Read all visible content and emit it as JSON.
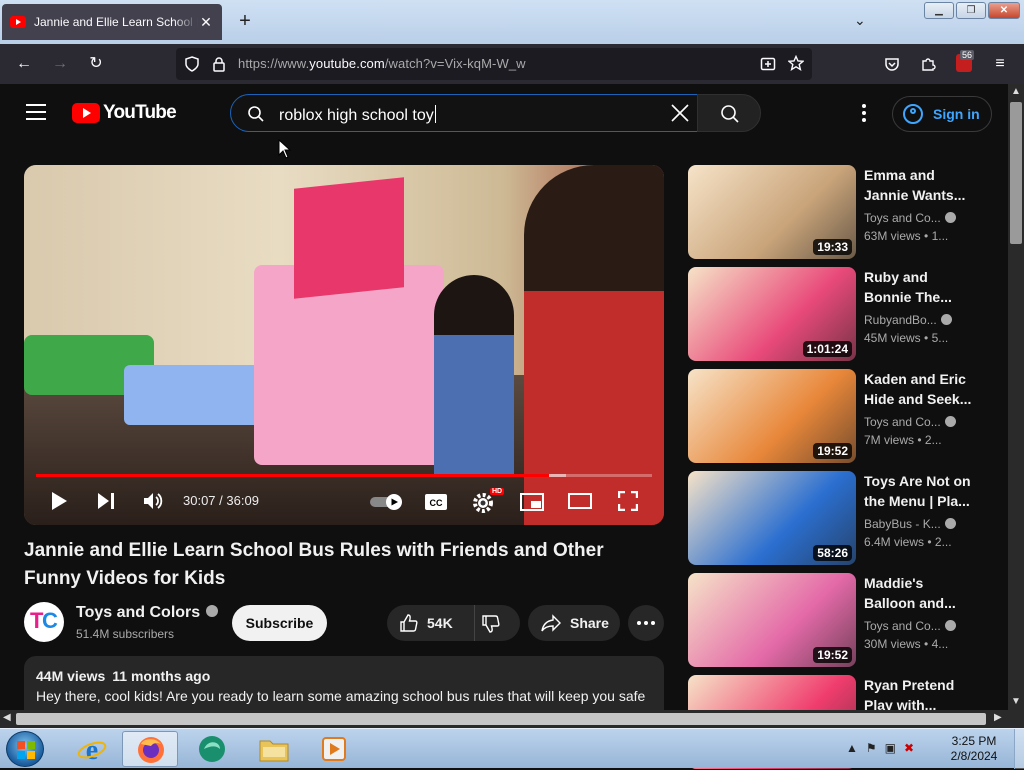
{
  "browser": {
    "tab_title": "Jannie and Ellie Learn School Bus Rules with Friends and Other Funny Videos for Kids",
    "new_tab": "+",
    "url_prefix": "https://www.",
    "url_domain": "youtube.com",
    "url_path": "/watch?v=Vix-kqM-W_w",
    "extension_badge": "56"
  },
  "youtube": {
    "logo_text": "YouTube",
    "search_query": "roblox high school toy",
    "sign_in": "Sign in"
  },
  "player": {
    "time_current": "30:07",
    "time_separator": " / ",
    "time_total": "36:09",
    "hd_badge": "HD",
    "progress_fraction": 0.833,
    "buffered_fraction": 0.86
  },
  "video": {
    "title": "Jannie and Ellie Learn School Bus Rules with Friends and Other Funny Videos for Kids",
    "channel": "Toys and Colors",
    "subscribers": "51.4M subscribers",
    "subscribe_label": "Subscribe",
    "likes": "54K",
    "share_label": "Share",
    "views": "44M views",
    "age": "11 months ago",
    "description": "Hey there, cool kids! Are you ready to learn some amazing school bus rules that will keep you safe"
  },
  "recommendations": [
    {
      "title": "Emma and Jannie Wants...",
      "channel": "Toys and Co...",
      "views": "63M views",
      "age": "1...",
      "duration": "19:33",
      "color": "#c9a47a"
    },
    {
      "title": "Ruby and Bonnie The...",
      "channel": "RubyandBo...",
      "views": "45M views",
      "age": "5...",
      "duration": "1:01:24",
      "color": "#e94a7a"
    },
    {
      "title": "Kaden and Eric Hide and Seek...",
      "channel": "Toys and Co...",
      "views": "7M views",
      "age": "2...",
      "duration": "19:52",
      "color": "#e8873a"
    },
    {
      "title": "Toys Are Not on the Menu | Pla...",
      "channel": "BabyBus - K...",
      "views": "6.4M views",
      "age": "2...",
      "duration": "58:26",
      "color": "#2b6fd0"
    },
    {
      "title": "Maddie's Balloon and...",
      "channel": "Toys and Co...",
      "views": "30M views",
      "age": "4...",
      "duration": "19:52",
      "color": "#e46aa8"
    },
    {
      "title": "Ryan Pretend Play with...",
      "channel": "",
      "views": "",
      "age": "",
      "duration": "",
      "color": "#f03d6e"
    }
  ],
  "taskbar": {
    "time": "3:25 PM",
    "date": "2/8/2024"
  }
}
